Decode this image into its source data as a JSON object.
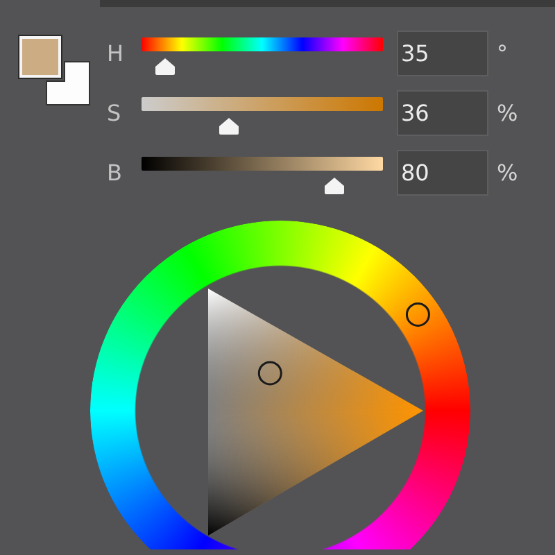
{
  "channels": [
    {
      "kind": "hue",
      "label": "H",
      "value": "35",
      "unit": "°",
      "level": 0.097
    },
    {
      "kind": "saturation",
      "label": "S",
      "value": "36",
      "unit": "%",
      "level": 0.36
    },
    {
      "kind": "brightness",
      "label": "B",
      "value": "80",
      "unit": "%",
      "level": 0.8
    }
  ]
}
